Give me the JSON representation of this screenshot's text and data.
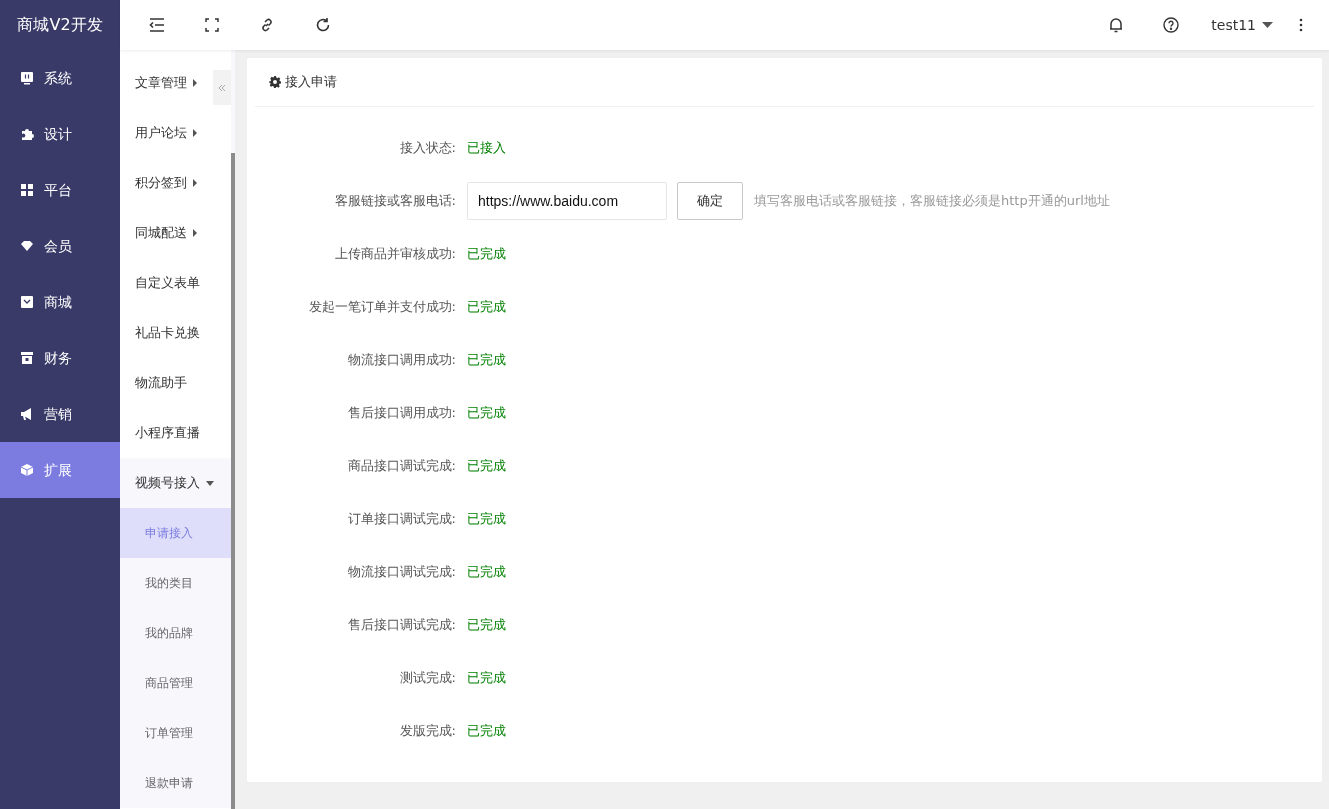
{
  "brand": "商城V2开发",
  "main_menu": [
    {
      "label": "系统",
      "selected": false
    },
    {
      "label": "设计",
      "selected": false
    },
    {
      "label": "平台",
      "selected": false
    },
    {
      "label": "会员",
      "selected": false
    },
    {
      "label": "商城",
      "selected": false
    },
    {
      "label": "财务",
      "selected": false
    },
    {
      "label": "营销",
      "selected": false
    },
    {
      "label": "扩展",
      "selected": true
    }
  ],
  "sub_menu": [
    {
      "label": "文章管理",
      "kind": "group",
      "expanded": false
    },
    {
      "label": "用户论坛",
      "kind": "group",
      "expanded": false
    },
    {
      "label": "积分签到",
      "kind": "group",
      "expanded": false
    },
    {
      "label": "同城配送",
      "kind": "group",
      "expanded": false
    },
    {
      "label": "自定义表单",
      "kind": "link"
    },
    {
      "label": "礼品卡兑换",
      "kind": "link"
    },
    {
      "label": "物流助手",
      "kind": "link"
    },
    {
      "label": "小程序直播",
      "kind": "link"
    },
    {
      "label": "视频号接入",
      "kind": "group",
      "expanded": true,
      "children": [
        {
          "label": "申请接入",
          "selected": true
        },
        {
          "label": "我的类目",
          "selected": false
        },
        {
          "label": "我的品牌",
          "selected": false
        },
        {
          "label": "商品管理",
          "selected": false
        },
        {
          "label": "订单管理",
          "selected": false
        },
        {
          "label": "退款申请",
          "selected": false
        }
      ]
    }
  ],
  "topbar": {
    "user": "test11"
  },
  "card": {
    "title": "接入申请",
    "rows": [
      {
        "kind": "status",
        "label": "接入状态:",
        "value": "已接入"
      },
      {
        "kind": "input",
        "label": "客服链接或客服电话:",
        "value": "https://www.baidu.com",
        "button": "确定",
        "hint": "填写客服电话或客服链接，客服链接必须是http开通的url地址"
      },
      {
        "kind": "status",
        "label": "上传商品并审核成功:",
        "value": "已完成"
      },
      {
        "kind": "status",
        "label": "发起一笔订单并支付成功:",
        "value": "已完成"
      },
      {
        "kind": "status",
        "label": "物流接口调用成功:",
        "value": "已完成"
      },
      {
        "kind": "status",
        "label": "售后接口调用成功:",
        "value": "已完成"
      },
      {
        "kind": "status",
        "label": "商品接口调试完成:",
        "value": "已完成"
      },
      {
        "kind": "status",
        "label": "订单接口调试完成:",
        "value": "已完成"
      },
      {
        "kind": "status",
        "label": "物流接口调试完成:",
        "value": "已完成"
      },
      {
        "kind": "status",
        "label": "售后接口调试完成:",
        "value": "已完成"
      },
      {
        "kind": "status",
        "label": "测试完成:",
        "value": "已完成"
      },
      {
        "kind": "status",
        "label": "发版完成:",
        "value": "已完成"
      }
    ]
  }
}
